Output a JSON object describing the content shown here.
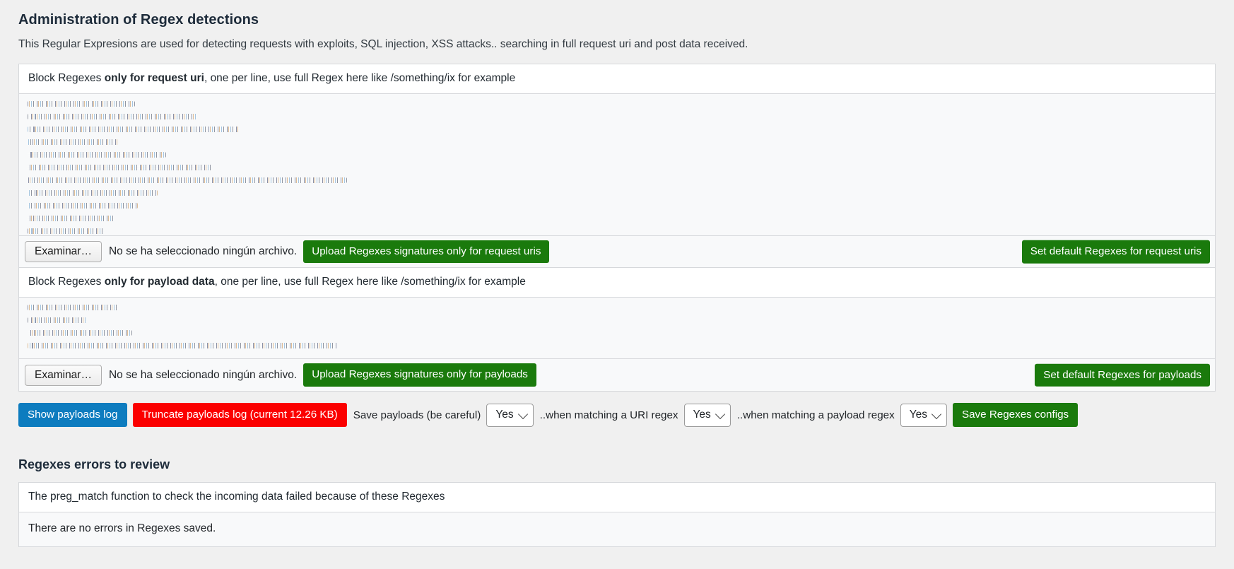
{
  "page": {
    "title": "Administration of Regex detections",
    "description": "This Regular Expresions are used for detecting requests with exploits, SQL injection, XSS attacks.. searching in full request uri and post data received."
  },
  "uri_section": {
    "head_prefix": "Block Regexes ",
    "head_strong": "only for request uri",
    "head_suffix": ", one per line, use full Regex here like /something/ix for example",
    "textarea_redacted_lines": 11,
    "file_button": "Examinar…",
    "file_status": "No se ha seleccionado ningún archivo.",
    "upload_button": "Upload Regexes signatures only for request uris",
    "default_button": "Set default Regexes for request uris"
  },
  "payload_section": {
    "head_prefix": "Block Regexes ",
    "head_strong": "only for payload data",
    "head_suffix": ", one per line, use full Regex here like /something/ix for example",
    "textarea_redacted_lines": 4,
    "file_button": "Examinar…",
    "file_status": "No se ha seleccionado ningún archivo.",
    "upload_button": "Upload Regexes signatures only for payloads",
    "default_button": "Set default Regexes for payloads"
  },
  "toolbar": {
    "show_log_button": "Show payloads log",
    "truncate_log_button": "Truncate payloads log (current 12.26 KB)",
    "save_payloads_label": "Save payloads (be careful)",
    "save_payloads_value": "Yes",
    "uri_match_label": "..when matching a URI regex",
    "uri_match_value": "Yes",
    "payload_match_label": "..when matching a payload regex",
    "payload_match_value": "Yes",
    "save_configs_button": "Save Regexes configs"
  },
  "errors_section": {
    "title": "Regexes errors to review",
    "head": "The preg_match function to check the incoming data failed because of these Regexes",
    "body": "There are no errors in Regexes saved."
  },
  "colors": {
    "green": "#1a7a0c",
    "blue": "#0d7cbf",
    "red": "#fb0000",
    "page_bg": "#f0f0f0",
    "panel_bg": "#f8f9fa",
    "border": "#d6d8db"
  }
}
